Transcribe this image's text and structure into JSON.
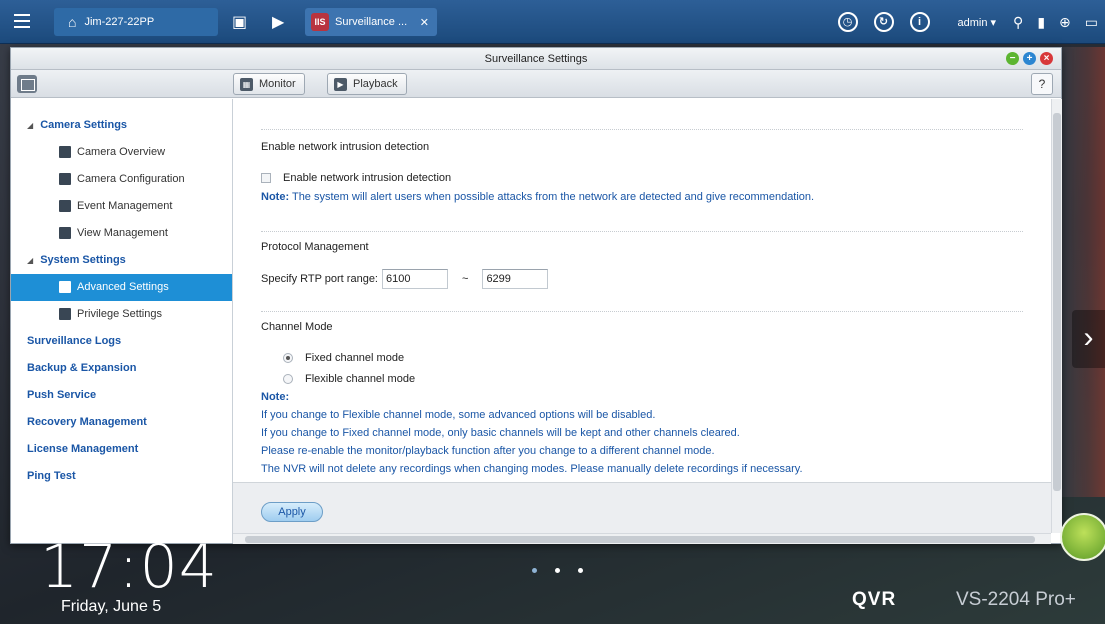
{
  "taskbar": {
    "host_label": "Jim-227-22PP",
    "app_tab_label": "Surveillance ...",
    "app_tab_close": "✕",
    "user_label": "admin ▾"
  },
  "window": {
    "title": "Surveillance Settings",
    "toolbar": {
      "monitor_label": "Monitor",
      "playback_label": "Playback",
      "help_label": "?"
    }
  },
  "sidebar": {
    "sections": [
      {
        "label": "Camera Settings",
        "expanded": true,
        "items": [
          {
            "label": "Camera Overview",
            "icon": "list-icon"
          },
          {
            "label": "Camera Configuration",
            "icon": "camera-icon"
          },
          {
            "label": "Event Management",
            "icon": "event-icon"
          },
          {
            "label": "View Management",
            "icon": "grid-icon"
          }
        ]
      },
      {
        "label": "System Settings",
        "expanded": true,
        "items": [
          {
            "label": "Advanced Settings",
            "icon": "wrench-icon",
            "active": true
          },
          {
            "label": "Privilege Settings",
            "icon": "user-icon"
          }
        ]
      }
    ],
    "links": [
      "Surveillance Logs",
      "Backup & Expansion",
      "Push Service",
      "Recovery Management",
      "License Management",
      "Ping Test"
    ]
  },
  "content": {
    "intrusion": {
      "title": "Enable network intrusion detection",
      "checkbox_label": "Enable network intrusion detection",
      "checked": false,
      "note_prefix": "Note:",
      "note_text": "The system will alert users when possible attacks from the network are detected and give recommendation."
    },
    "protocol": {
      "title": "Protocol Management",
      "rtp_label": "Specify RTP port range:",
      "port_from": "6100",
      "separator": "~",
      "port_to": "6299"
    },
    "channel": {
      "title": "Channel Mode",
      "options": [
        {
          "label": "Fixed channel mode",
          "selected": true
        },
        {
          "label": "Flexible channel mode",
          "selected": false
        }
      ],
      "note_title": "Note:",
      "notes": [
        "If you change to Flexible channel mode, some advanced options will be disabled.",
        "If you change to Fixed channel mode, only basic channels will be kept and other channels cleared.",
        "Please re-enable the monitor/playback function after you change to a different channel mode.",
        "The NVR will not delete any recordings when changing modes. Please manually delete recordings if necessary."
      ]
    },
    "apply_label": "Apply"
  },
  "desktop": {
    "time": "17:04",
    "date": "Friday, June 5",
    "brand": "QVR",
    "model": "VS-2204 Pro+"
  },
  "colors": {
    "taskbar": "#1c4a7c",
    "link": "#1a56a6",
    "active_item": "#1e8fd6"
  }
}
